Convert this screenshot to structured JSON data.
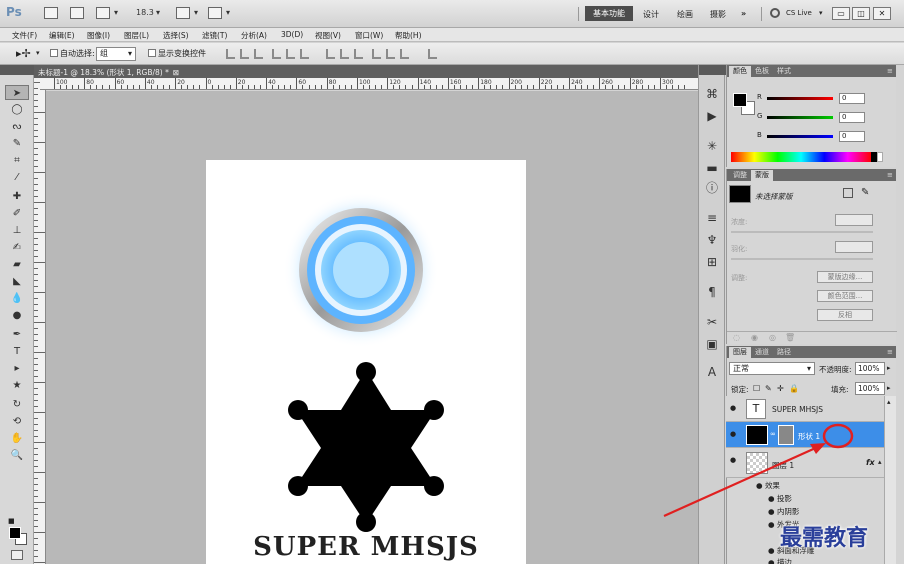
{
  "appbar": {
    "logo": "Ps",
    "zoom": "18.3",
    "workspaces": [
      "基本功能",
      "设计",
      "绘画",
      "摄影"
    ],
    "more": "»",
    "cslive": "CS Live"
  },
  "menu": [
    "文件(F)",
    "编辑(E)",
    "图像(I)",
    "图层(L)",
    "选择(S)",
    "滤镜(T)",
    "分析(A)",
    "3D(D)",
    "视图(V)",
    "窗口(W)",
    "帮助(H)"
  ],
  "options": {
    "auto_select_label": "自动选择:",
    "auto_select_value": "组",
    "show_transform_label": "显示变换控件"
  },
  "document": {
    "tab_title": "未标题-1 @ 18.3% (形状 1, RGB/8) *",
    "ruler_labels": [
      "100",
      "80",
      "60",
      "40",
      "20",
      "0",
      "20",
      "40",
      "60",
      "80",
      "100",
      "120",
      "140",
      "160",
      "180",
      "200",
      "220",
      "240",
      "260",
      "280",
      "300"
    ],
    "canvas_text": "SUPER MHSJS"
  },
  "color_panel": {
    "tabs": [
      "颜色",
      "色板",
      "样式"
    ],
    "channels": [
      {
        "label": "R",
        "value": "0",
        "color": "#d01010"
      },
      {
        "label": "G",
        "value": "0",
        "color": "#10a010"
      },
      {
        "label": "B",
        "value": "0",
        "color": "#1030d0"
      }
    ]
  },
  "mask_panel": {
    "tabs": [
      "调整",
      "蒙版"
    ],
    "status": "未选择蒙版",
    "density_label": "浓度:",
    "feather_label": "羽化:",
    "refine_label": "调整:",
    "buttons": [
      "蒙版边缘...",
      "颜色范围...",
      "反相"
    ]
  },
  "layers_panel": {
    "tabs": [
      "图层",
      "通道",
      "路径"
    ],
    "blend_mode": "正常",
    "opacity_label": "不透明度:",
    "opacity_value": "100%",
    "lock_label": "锁定:",
    "fill_label": "填充:",
    "fill_value": "100%",
    "layers": [
      {
        "name": "SUPER MHSJS",
        "type": "text",
        "thumb": "T"
      },
      {
        "name": "形状 1",
        "type": "shape",
        "selected": true
      },
      {
        "name": "图层 1",
        "type": "raster",
        "fx": "fx"
      }
    ],
    "effects_label": "效果",
    "effects": [
      "投影",
      "内阴影",
      "外发光",
      "斜面和浮雕",
      "描边"
    ]
  },
  "watermark": "最需教育",
  "accent": "#3d8ee8"
}
